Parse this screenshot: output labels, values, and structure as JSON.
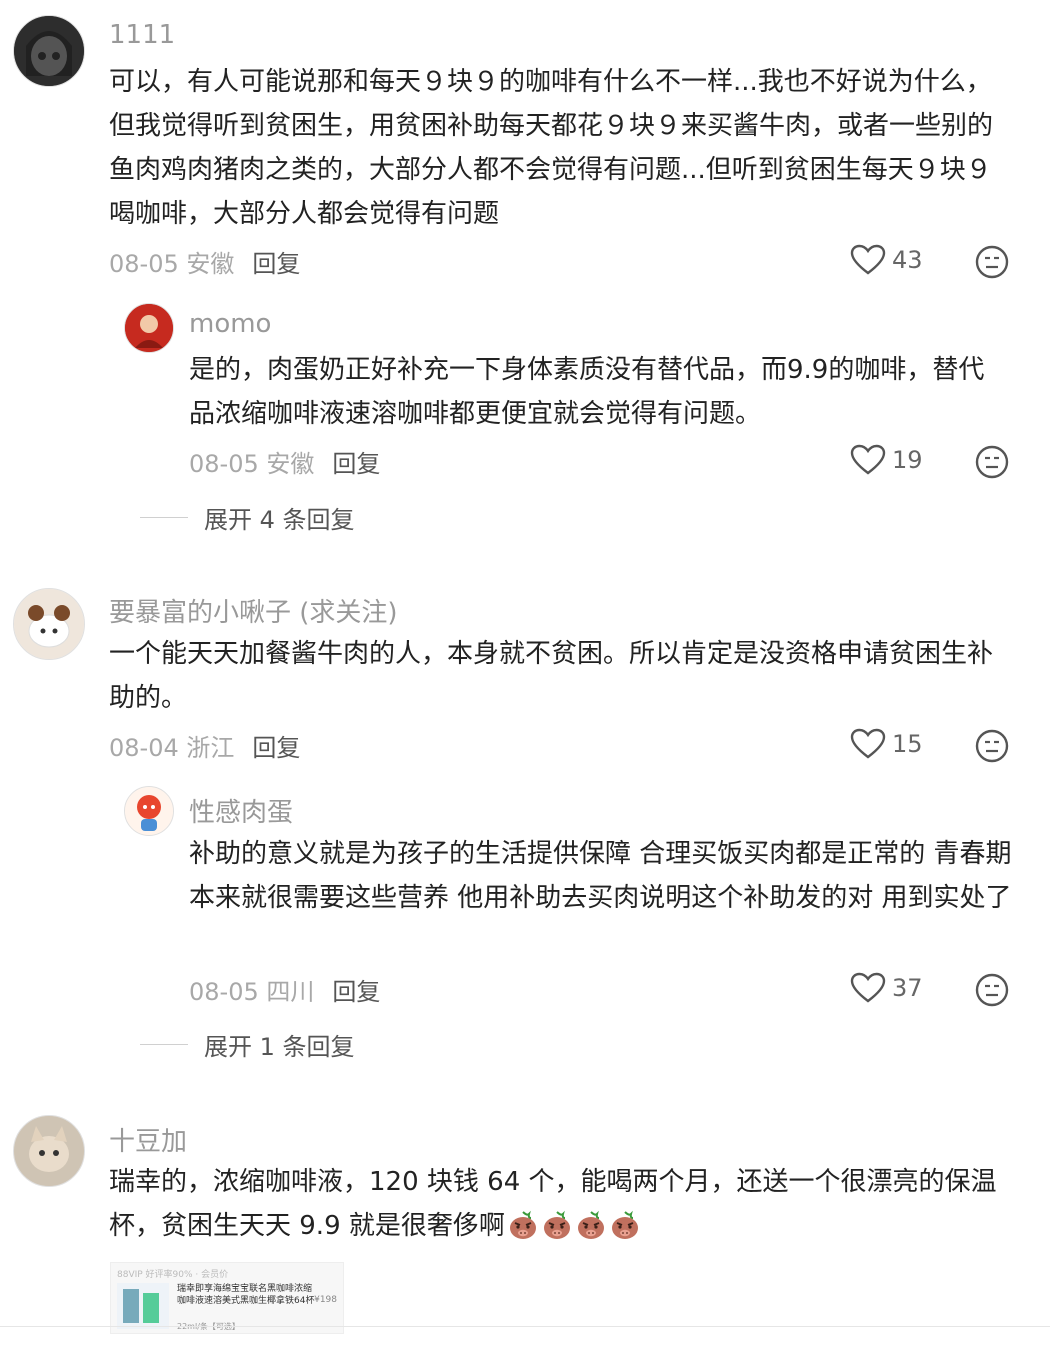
{
  "comments": [
    {
      "username": "1111",
      "text": "可以，有人可能说那和每天９块９的咖啡有什么不一样...我也不好说为什么，但我觉得听到贫困生，用贫困补助每天都花９块９来买酱牛肉，或者一些别的鱼肉鸡肉猪肉之类的，大部分人都不会觉得有问题...但听到贫困生每天９块９喝咖啡，大部分人都会觉得有问题",
      "date_location": "08-05 安徽",
      "reply_label": "回复",
      "likes": "43",
      "replies": [
        {
          "username": "momo",
          "text": "是的，肉蛋奶正好补充一下身体素质没有替代品，而9.9的咖啡，替代品浓缩咖啡液速溶咖啡都更便宜就会觉得有问题。",
          "date_location": "08-05 安徽",
          "reply_label": "回复",
          "likes": "19"
        }
      ],
      "expand_label": "展开 4 条回复"
    },
    {
      "username": "要暴富的小啾子 (求关注)",
      "text": "一个能天天加餐酱牛肉的人，本身就不贫困。所以肯定是没资格申请贫困生补助的。",
      "date_location": "08-04 浙江",
      "reply_label": "回复",
      "likes": "15",
      "replies": [
        {
          "username": "性感肉蛋",
          "text": "补助的意义就是为孩子的生活提供保障 合理买饭买肉都是正常的 青春期本来就很需要这些营养 他用补助去买肉说明这个补助发的对 用到实处了",
          "date_location": "08-05 四川",
          "reply_label": "回复",
          "likes": "37"
        }
      ],
      "expand_label": "展开 1 条回复"
    },
    {
      "username": "十豆加",
      "text": "瑞幸的，浓缩咖啡液，120 块钱 64 个，能喝两个月，还送一个很漂亮的保温杯，贫困生天天 9.9 就是很奢侈啊",
      "emoji_count": 4,
      "preview": {
        "topline": "88VIP 好评率90% · 会员价",
        "title": "瑞幸即享海绵宝宝联名黑咖啡浓缩咖啡液速溶美式黑咖生椰拿铁64杯",
        "price": "¥198",
        "note": "22ml/条【可选】"
      }
    }
  ],
  "icons": {
    "like": "heart-outline-icon",
    "dislike": "dislike-face-icon",
    "emoji": "angry-pig-emoji"
  },
  "colors": {
    "username": "#999999",
    "text": "#222222",
    "meta": "#a8a8a8",
    "reply": "#555555"
  }
}
